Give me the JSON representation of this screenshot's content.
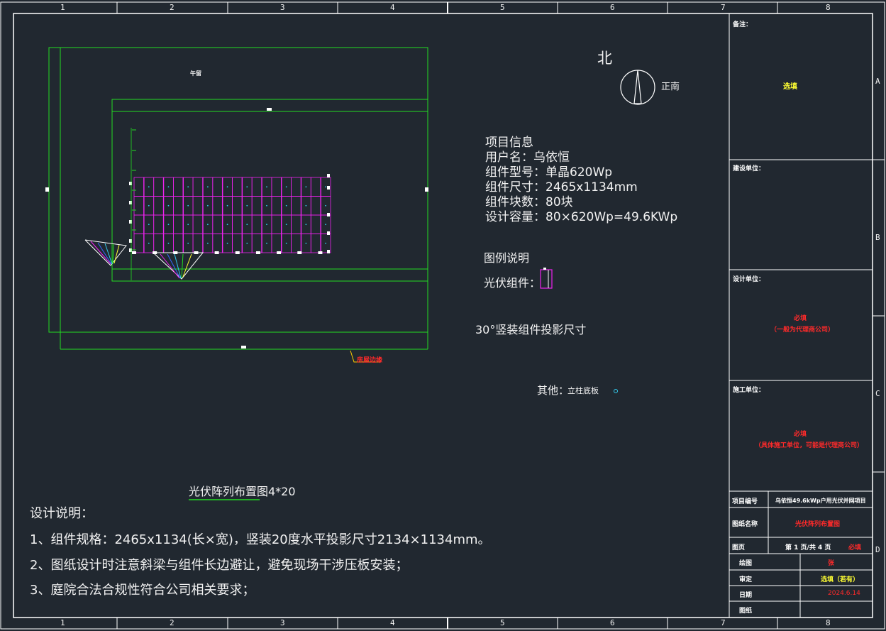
{
  "colors": {
    "background": "#212830",
    "frame": "#ffffff",
    "boundary": "#22dd22",
    "panel": "#ee22ee",
    "cyan": "#33ccee",
    "red": "#ff2a2a",
    "yellow": "#ffff33"
  },
  "grid": {
    "top_numbers": [
      "1",
      "2",
      "3",
      "4",
      "5",
      "6",
      "7",
      "8"
    ],
    "bottom_numbers": [
      "1",
      "2",
      "3",
      "4",
      "5",
      "6",
      "7",
      "8"
    ],
    "side_letters": [
      "A",
      "B",
      "C",
      "D"
    ]
  },
  "drawing": {
    "site_label": "午留",
    "house_label": "房屋边缘",
    "north_text": "北",
    "due_south": "正南",
    "array_title": "光伏阵列布置图4*20",
    "array_rows": 4,
    "array_cols": 20
  },
  "project_info": {
    "heading": "项目信息",
    "lines": [
      "用户名：乌依恒",
      "组件型号：单晶620Wp",
      "组件尺寸：2465x1134mm",
      "组件块数：80块",
      "设计容量：80×620Wp=49.6KWp"
    ]
  },
  "legend": {
    "heading": "图例说明",
    "pv_module": "光伏组件：",
    "projection": "30°竖装组件投影尺寸",
    "other_label": "其他：",
    "other_item": "立柱底板"
  },
  "design_notes": {
    "heading": "设计说明：",
    "items": [
      "1、组件规格：2465x1134(长×宽)，竖装20度水平投影尺寸2134×1134mm。",
      "2、图纸设计时注意斜梁与组件长边避让，避免现场干涉压板安装；",
      "3、庭院合法合规性符合公司相关要求；"
    ]
  },
  "title_block": {
    "remarks_label": "备注：",
    "remarks_value": "选填",
    "builder_label": "建设单位：",
    "designer_label": "设计单位：",
    "designer_value": "必填",
    "designer_note": "（一般为代理商公司）",
    "contractor_label": "施工单位：",
    "contractor_value": "必填",
    "contractor_note": "（具体施工单位，可能是代理商公司）",
    "project_no_label": "项目编号",
    "project_no_value": "乌依恒49.6kWp户用光伏并网项目",
    "drawing_name_label": "图纸名称",
    "drawing_name_value": "光伏阵列布置图",
    "page_label": "图页",
    "page_value": "第 1 页/共 4 页",
    "page_required": "必填",
    "drawn_label": "绘图",
    "drawn_value": "张",
    "review_label": "审定",
    "review_value": "选填（若有）",
    "date_label": "日期",
    "date_value": "2024.6.14",
    "drawing_no_label": "图纸"
  }
}
